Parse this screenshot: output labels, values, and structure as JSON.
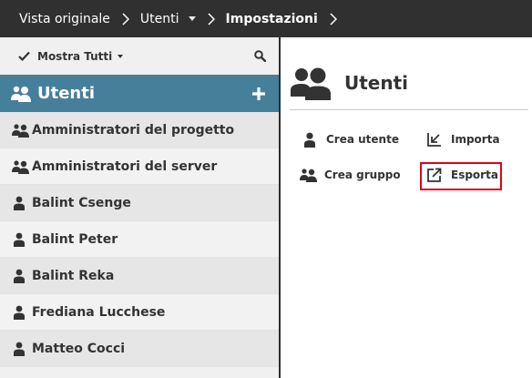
{
  "breadcrumb": {
    "items": [
      {
        "label": "Vista originale"
      },
      {
        "label": "Utenti"
      },
      {
        "label": "Impostazioni"
      }
    ]
  },
  "filter": {
    "label": "Mostra Tutti"
  },
  "section": {
    "title": "Utenti"
  },
  "users": [
    {
      "name": "Amministratori del progetto",
      "icon": "users-group-icon"
    },
    {
      "name": "Amministratori del server",
      "icon": "users-group-icon"
    },
    {
      "name": "Balint Csenge",
      "icon": "user-icon"
    },
    {
      "name": "Balint Peter",
      "icon": "user-icon"
    },
    {
      "name": "Balint Reka",
      "icon": "user-icon"
    },
    {
      "name": "Frediana Lucchese",
      "icon": "user-icon"
    },
    {
      "name": "Matteo Cocci",
      "icon": "user-icon"
    }
  ],
  "panel": {
    "title": "Utenti",
    "actions": {
      "create_user": "Crea utente",
      "import": "Importa",
      "create_group": "Crea gruppo",
      "export": "Esporta"
    }
  },
  "colors": {
    "topbar": "#303030",
    "section_header": "#467f9a",
    "highlight": "#e0001b"
  }
}
